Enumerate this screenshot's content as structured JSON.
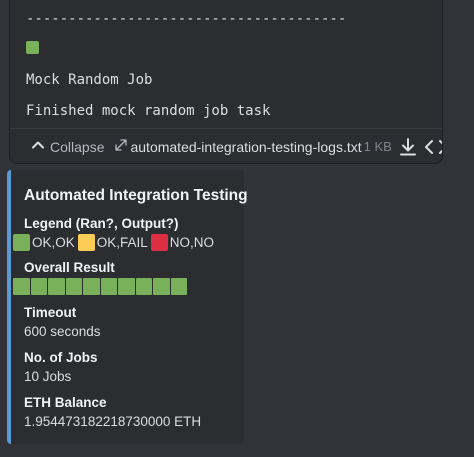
{
  "attachment": {
    "code_lines": [
      "--------------------------------------",
      "Mock Random Job",
      "Finished mock random job task"
    ],
    "status_color": "#78b159",
    "collapse_label": "Collapse",
    "filename": "automated-integration-testing-logs.txt",
    "filesize": "1 KB",
    "icons": [
      "chevron-up-icon",
      "expand-icon",
      "download-icon",
      "code-icon"
    ]
  },
  "embed": {
    "accent_color": "#5b9bd5",
    "title": "Automated Integration Testing",
    "legend": {
      "name": "Legend (Ran?, Output?)",
      "items": [
        {
          "color": "#78b159",
          "label": "OK,OK"
        },
        {
          "color": "#fdcb58",
          "label": "OK,FAIL"
        },
        {
          "color": "#dd2e44",
          "label": "NO,NO"
        }
      ]
    },
    "overall_result": {
      "name": "Overall Result",
      "cells": [
        "ok",
        "ok",
        "ok",
        "ok",
        "ok",
        "ok",
        "ok",
        "ok",
        "ok",
        "ok"
      ]
    },
    "timeout": {
      "name": "Timeout",
      "value": "600 seconds"
    },
    "jobs": {
      "name": "No. of Jobs",
      "value": "10 Jobs"
    },
    "balance": {
      "name": "ETH Balance",
      "value": "1.954473182218730000 ETH"
    }
  }
}
